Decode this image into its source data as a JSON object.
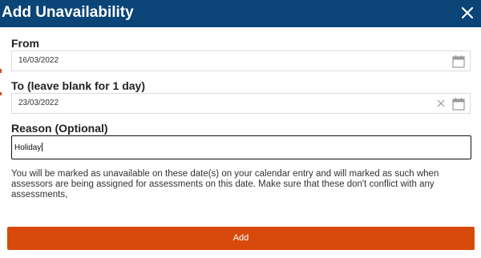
{
  "dialog": {
    "title": "Add Unavailability",
    "close_icon": "close-icon"
  },
  "from": {
    "label": "From",
    "value": "16/03/2022",
    "icon": "calendar-icon"
  },
  "to": {
    "label": "To (leave blank for 1 day)",
    "value": "23/03/2022",
    "clear_icon": "clear-icon",
    "icon": "calendar-icon"
  },
  "reason": {
    "label": "Reason (Optional)",
    "value": "Holiday"
  },
  "note": "You will be marked as unavailable on these date(s) on your calendar entry and will marked as such when assessors are being assigned for assessments on this date. Make sure that these don't conflict with any assessments,",
  "actions": {
    "add_label": "Add"
  },
  "colors": {
    "header": "#0b4477",
    "primary_button": "#d84a0c"
  }
}
